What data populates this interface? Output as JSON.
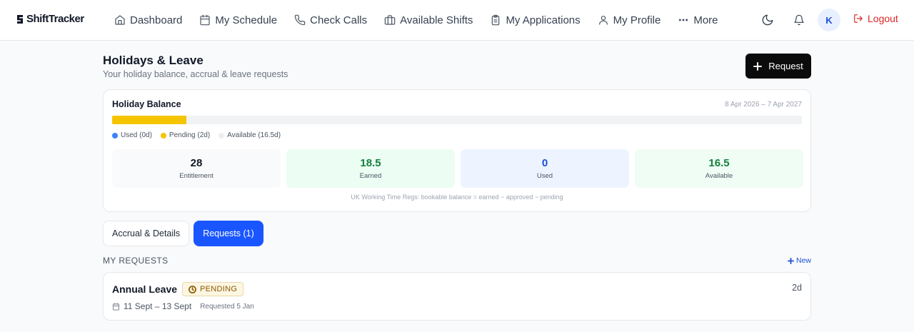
{
  "brand": {
    "name": "ShiftTracker"
  },
  "nav": {
    "items": [
      {
        "label": "Dashboard",
        "icon": "home-icon"
      },
      {
        "label": "My Schedule",
        "icon": "calendar-icon"
      },
      {
        "label": "Check Calls",
        "icon": "phone-icon"
      },
      {
        "label": "Available Shifts",
        "icon": "briefcase-icon"
      },
      {
        "label": "My Applications",
        "icon": "clipboard-icon"
      },
      {
        "label": "My Profile",
        "icon": "user-icon"
      },
      {
        "label": "More",
        "icon": "ellipsis-icon"
      }
    ]
  },
  "header_actions": {
    "avatar_initial": "K",
    "logout_label": "Logout"
  },
  "page": {
    "title": "Holidays & Leave",
    "subtitle": "Your holiday balance, accrual & leave requests",
    "request_button": "Request"
  },
  "balance": {
    "title": "Holiday Balance",
    "period": "8 Apr 2026 – 7 Apr 2027",
    "bar_pending_fraction": 0.1075,
    "legend": [
      {
        "label": "Used (0d)",
        "color": "#3b82f6"
      },
      {
        "label": "Pending (2d)",
        "color": "#f5c400"
      },
      {
        "label": "Available (16.5d)",
        "color": "#eeeeee"
      }
    ],
    "stats": [
      {
        "value": "28",
        "label": "Entitlement",
        "bg": "#f9fafb",
        "color": "#111827"
      },
      {
        "value": "18.5",
        "label": "Earned",
        "bg": "#ecfdf3",
        "color": "#15803d"
      },
      {
        "value": "0",
        "label": "Used",
        "bg": "#eef4ff",
        "color": "#1d4ed8"
      },
      {
        "value": "16.5",
        "label": "Available",
        "bg": "#effdf4",
        "color": "#15803d"
      }
    ],
    "note": "UK Working Time Regs: bookable balance = earned − approved − pending"
  },
  "tabs": [
    {
      "label": "Accrual & Details",
      "active": false
    },
    {
      "label": "Requests (1)",
      "active": true
    }
  ],
  "requests": {
    "section_label": "MY REQUESTS",
    "new_label": "New",
    "items": [
      {
        "type": "Annual Leave",
        "status": "PENDING",
        "days": "2d",
        "dates": "11 Sept – 13 Sept",
        "requested": "Requested 5 Jan"
      }
    ]
  }
}
